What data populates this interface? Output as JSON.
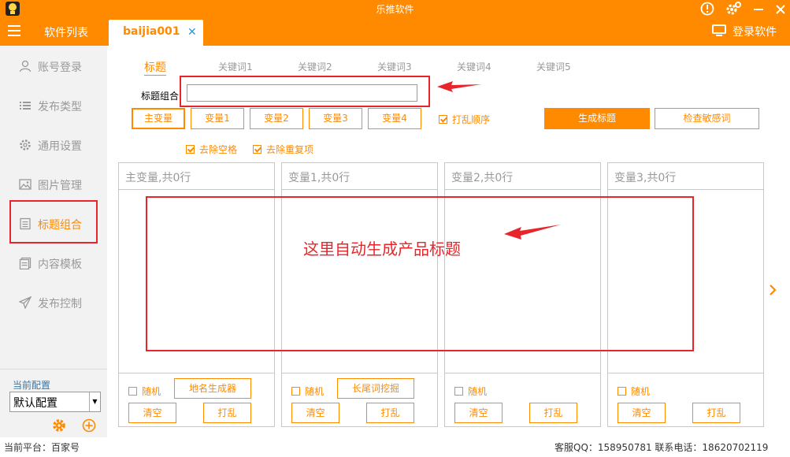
{
  "app": {
    "title": "乐推软件"
  },
  "tabs": {
    "list_label": "软件列表",
    "active_label": "baijia001",
    "close_glyph": "✕",
    "login_label": "登录软件"
  },
  "sidebar": {
    "items": [
      {
        "label": "账号登录",
        "icon": "user-icon"
      },
      {
        "label": "发布类型",
        "icon": "list-icon"
      },
      {
        "label": "通用设置",
        "icon": "gear-icon"
      },
      {
        "label": "图片管理",
        "icon": "image-icon"
      },
      {
        "label": "标题组合",
        "icon": "doc-icon"
      },
      {
        "label": "内容模板",
        "icon": "template-icon"
      },
      {
        "label": "发布控制",
        "icon": "send-icon"
      }
    ],
    "active_index": 4,
    "current_config_label": "当前配置",
    "config_value": "默认配置"
  },
  "keyword_tabs": [
    "标题",
    "关键词1",
    "关键词2",
    "关键词3",
    "关键词4",
    "关键词5"
  ],
  "title_combo": {
    "label": "标题组合",
    "value": ""
  },
  "var_buttons": [
    "主变量",
    "变量1",
    "变量2",
    "变量3",
    "变量4"
  ],
  "shuffle_order": {
    "label": "打乱顺序",
    "checked": true
  },
  "generate_label": "生成标题",
  "check_sensitive_label": "检查敏感词",
  "remove_spaces": {
    "label": "去除空格",
    "checked": true
  },
  "remove_duplicates": {
    "label": "去除重复项",
    "checked": true
  },
  "panels": [
    {
      "title": "主变量,共0行",
      "random_label": "随机",
      "extra_button": "地名生成器",
      "clear_label": "清空",
      "shuffle_label": "打乱"
    },
    {
      "title": "变量1,共0行",
      "random_label": "随机",
      "extra_button": "长尾词挖掘",
      "clear_label": "清空",
      "shuffle_label": "打乱"
    },
    {
      "title": "变量2,共0行",
      "random_label": "随机",
      "extra_button": "",
      "clear_label": "清空",
      "shuffle_label": "打乱"
    },
    {
      "title": "变量3,共0行",
      "random_label": "随机",
      "extra_button": "",
      "clear_label": "清空",
      "shuffle_label": "打乱"
    }
  ],
  "annotation": {
    "text": "这里自动生成产品标题",
    "color": "#e8252a"
  },
  "status": {
    "platform": "当前平台：百家号",
    "contact": "客服QQ：158950781   联系电话：18620702119"
  },
  "colors": {
    "accent": "#ff8a00",
    "annotation": "#e8252a"
  }
}
